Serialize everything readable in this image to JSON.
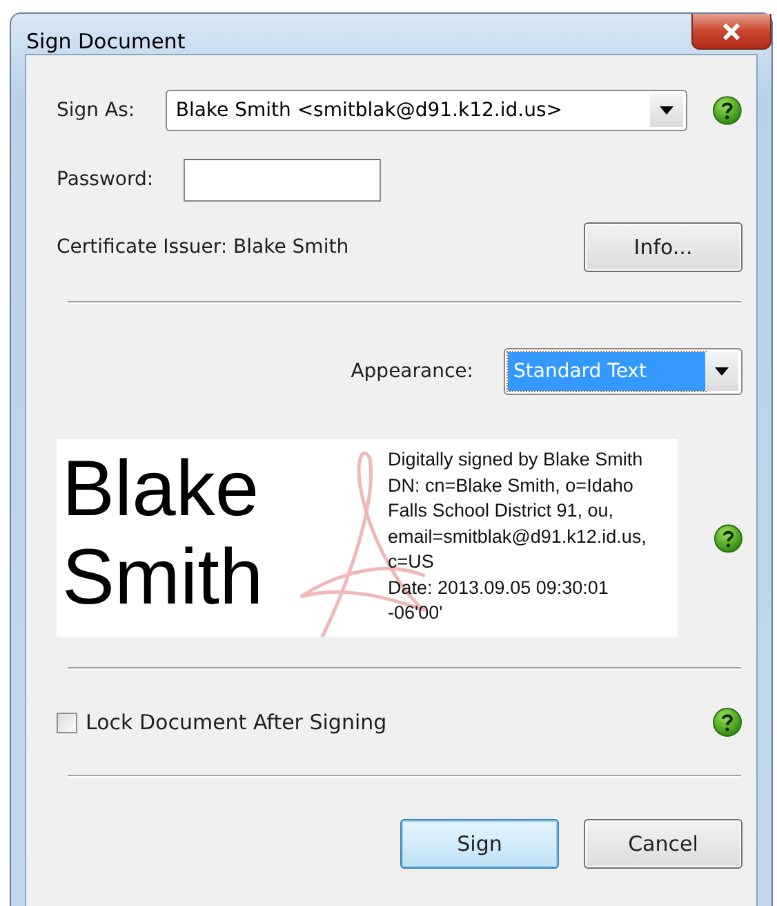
{
  "window": {
    "title": "Sign Document"
  },
  "sign_as": {
    "label": "Sign As:",
    "value": "Blake Smith <smitblak@d91.k12.id.us>"
  },
  "password": {
    "label": "Password:"
  },
  "certificate_issuer": "Certificate Issuer: Blake Smith",
  "info_button": "Info...",
  "appearance": {
    "label": "Appearance:",
    "value": "Standard Text",
    "highlighted": true
  },
  "preview": {
    "name_lines": [
      "Blake",
      "Smith"
    ],
    "details": [
      "Digitally signed by Blake Smith",
      "DN: cn=Blake Smith, o=Idaho",
      "Falls School District 91, ou,",
      "email=smitblak@d91.k12.id.us,",
      "c=US",
      "Date: 2013.09.05 09:30:01",
      "-06'00'"
    ]
  },
  "lock_document": {
    "label": "Lock Document After Signing",
    "checked": false
  },
  "buttons": [
    {
      "label": "Sign",
      "default": true
    },
    {
      "label": "Cancel",
      "default": false
    }
  ]
}
